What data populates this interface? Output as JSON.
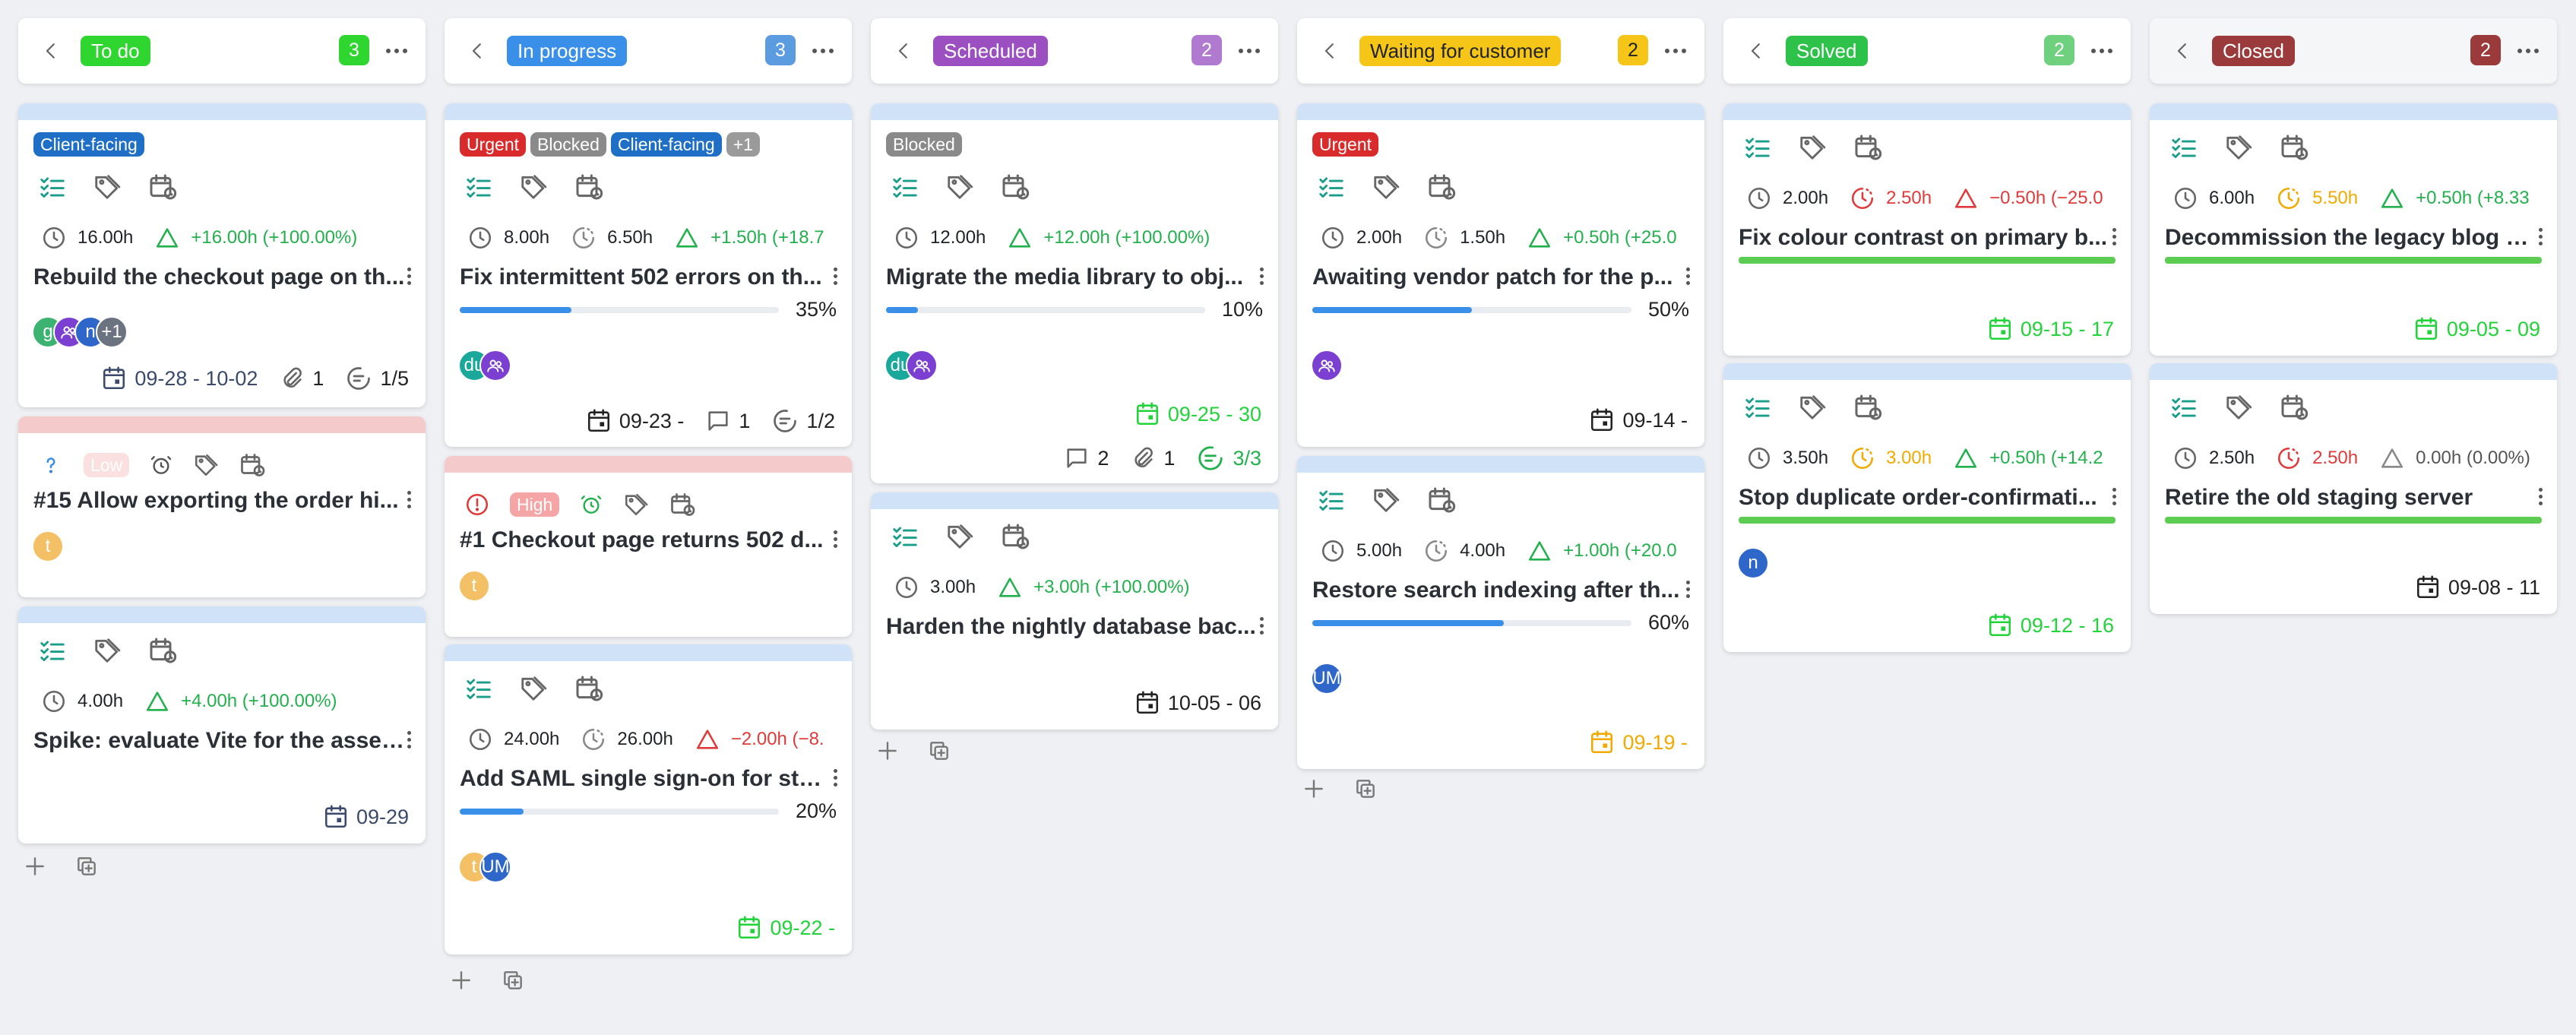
{
  "columns": [
    {
      "status": "To do",
      "status_color": "#2fd62f",
      "status_text_color": "#ffffff",
      "count": "3",
      "count_color": "#2fd62f",
      "cards": [
        {
          "tags": [
            {
              "label": "Client-facing",
              "color": "#1f6fc7"
            }
          ],
          "spent": "16.00h",
          "delta": "+16.00h (+100.00%)",
          "title": "Rebuild the checkout page on th...",
          "avatars": [
            "g",
            "",
            "n",
            "+1"
          ],
          "dates": "09-28 - 10-02",
          "attachments": "1",
          "checklist": "1/5"
        },
        {
          "priority": "Low",
          "title": "#15 Allow exporting the order hi...",
          "avatars": [
            "t"
          ]
        },
        {
          "spent": "4.00h",
          "delta": "+4.00h (+100.00%)",
          "title": "Spike: evaluate Vite for the asset...",
          "dates": "09-29"
        }
      ]
    },
    {
      "status": "In progress",
      "status_color": "#3a8fe8",
      "status_text_color": "#ffffff",
      "count": "3",
      "count_color": "#5b9be0",
      "cards": [
        {
          "tags": [
            {
              "label": "Urgent",
              "color": "#d92b2b"
            },
            {
              "label": "Blocked",
              "color": "#8a8a8a"
            },
            {
              "label": "Client-facing",
              "color": "#1f6fc7"
            },
            {
              "label": "+1",
              "color": "#9a9a9a"
            }
          ],
          "estimate": "8.00h",
          "spent": "6.50h",
          "delta": "+1.50h (+18.7",
          "title": "Fix intermittent 502 errors on th...",
          "progress": "35%",
          "progress_value": 35,
          "avatars": [
            "du",
            ""
          ],
          "dates": "09-23 -",
          "comments": "1",
          "checklist": "1/2"
        },
        {
          "priority": "High",
          "title": "#1 Checkout page returns 502 d...",
          "avatars": [
            "t"
          ]
        },
        {
          "estimate": "24.00h",
          "spent": "26.00h",
          "delta": "−2.00h (−8.",
          "title": "Add SAML single sign-on for staf...",
          "progress": "20%",
          "progress_value": 20,
          "avatars": [
            "t",
            "UM"
          ],
          "dates": "09-22 -"
        }
      ]
    },
    {
      "status": "Scheduled",
      "status_color": "#9b4fc0",
      "status_text_color": "#ffffff",
      "count": "2",
      "count_color": "#b07ad0",
      "cards": [
        {
          "tags": [
            {
              "label": "Blocked",
              "color": "#8a8a8a"
            }
          ],
          "spent": "12.00h",
          "delta": "+12.00h (+100.00%)",
          "title": "Migrate the media library to obj...",
          "progress": "10%",
          "progress_value": 10,
          "avatars": [
            "du",
            ""
          ],
          "dates": "09-25 - 30",
          "comments": "2",
          "attachments": "1",
          "checklist": "3/3"
        },
        {
          "spent": "3.00h",
          "delta": "+3.00h (+100.00%)",
          "title": "Harden the nightly database bac...",
          "dates": "10-05 - 06"
        }
      ]
    },
    {
      "status": "Waiting for customer",
      "status_color": "#f5c518",
      "status_text_color": "#1f2328",
      "count": "2",
      "count_color": "#f5c518",
      "cards": [
        {
          "tags": [
            {
              "label": "Urgent",
              "color": "#d92b2b"
            }
          ],
          "estimate": "2.00h",
          "spent": "1.50h",
          "delta": "+0.50h (+25.0",
          "title": "Awaiting vendor patch for the p...",
          "progress": "50%",
          "progress_value": 50,
          "avatars": [
            ""
          ],
          "dates": "09-14 -"
        },
        {
          "estimate": "5.00h",
          "spent": "4.00h",
          "delta": "+1.00h (+20.0",
          "title": "Restore search indexing after th...",
          "progress": "60%",
          "progress_value": 60,
          "avatars": [
            "UM"
          ],
          "dates": "09-19 -"
        }
      ]
    },
    {
      "status": "Solved",
      "status_color": "#2fc24a",
      "status_text_color": "#ffffff",
      "count": "2",
      "count_color": "#6fd07e",
      "cards": [
        {
          "estimate": "2.00h",
          "spent": "2.50h",
          "delta": "−0.50h (−25.0",
          "title": "Fix colour contrast on primary b...",
          "dates": "09-15 - 17"
        },
        {
          "estimate": "3.50h",
          "spent": "3.00h",
          "delta": "+0.50h (+14.2",
          "title": "Stop duplicate order-confirmati...",
          "avatars": [
            "n"
          ],
          "dates": "09-12 - 16"
        }
      ]
    },
    {
      "status": "Closed",
      "status_color": "#9a3a3a",
      "status_text_color": "#ffffff",
      "count": "2",
      "count_color": "#9a3a3a",
      "cards": [
        {
          "estimate": "6.00h",
          "spent": "5.50h",
          "delta": "+0.50h (+8.33",
          "title": "Decommission the legacy blog a...",
          "dates": "09-05 - 09"
        },
        {
          "estimate": "2.50h",
          "spent": "2.50h",
          "delta": "0.00h (0.00%)",
          "title": "Retire the old staging server",
          "dates": "09-08 - 11"
        }
      ]
    }
  ],
  "colors": {
    "accent_teal": "#1a9e8a",
    "progress_blue": "#3a8fe8",
    "done_green": "#5ccc52",
    "date_green": "#22d33a",
    "date_orange": "#f2a900"
  }
}
